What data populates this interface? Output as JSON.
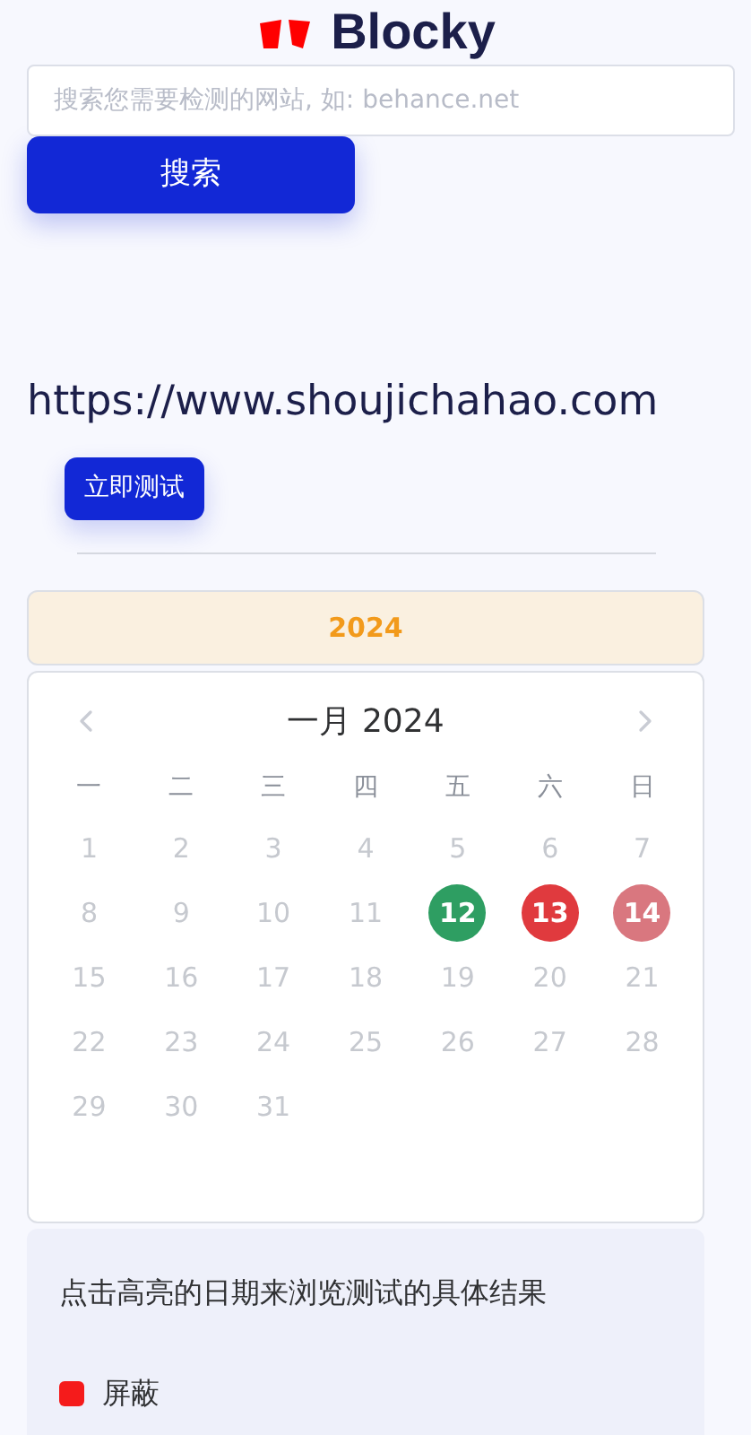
{
  "logo": {
    "text": "Blocky"
  },
  "search": {
    "placeholder": "搜索您需要检测的网站, 如: behance.net",
    "button": "搜索"
  },
  "url": "https://www.shoujichahao.com",
  "test_button": "立即测试",
  "year": "2024",
  "calendar": {
    "title": "一月 2024",
    "weekdays": [
      "一",
      "二",
      "三",
      "四",
      "五",
      "六",
      "日"
    ],
    "days": [
      {
        "day": "1"
      },
      {
        "day": "2"
      },
      {
        "day": "3"
      },
      {
        "day": "4"
      },
      {
        "day": "5"
      },
      {
        "day": "6"
      },
      {
        "day": "7"
      },
      {
        "day": "8"
      },
      {
        "day": "9"
      },
      {
        "day": "10"
      },
      {
        "day": "11"
      },
      {
        "day": "12",
        "color": "#2e9e62"
      },
      {
        "day": "13",
        "color": "#e03a3e"
      },
      {
        "day": "14",
        "color": "#d9777f"
      },
      {
        "day": "15"
      },
      {
        "day": "16"
      },
      {
        "day": "17"
      },
      {
        "day": "18"
      },
      {
        "day": "19"
      },
      {
        "day": "20"
      },
      {
        "day": "21"
      },
      {
        "day": "22"
      },
      {
        "day": "23"
      },
      {
        "day": "24"
      },
      {
        "day": "25"
      },
      {
        "day": "26"
      },
      {
        "day": "27"
      },
      {
        "day": "28"
      },
      {
        "day": "29"
      },
      {
        "day": "30"
      },
      {
        "day": "31"
      }
    ]
  },
  "legend": {
    "hint": "点击高亮的日期来浏览测试的具体结果",
    "items": [
      {
        "label": "屏蔽",
        "color": "#f51b1b"
      }
    ]
  }
}
